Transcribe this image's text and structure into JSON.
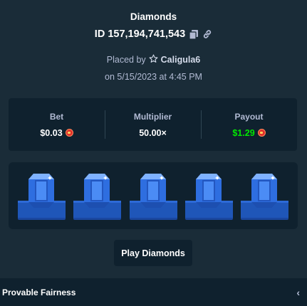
{
  "header": {
    "title": "Diamonds",
    "bet_id": "ID 157,194,741,543",
    "placed_by_prefix": "Placed by",
    "username": "Caligula6",
    "date_text": "on 5/15/2023 at 4:45 PM"
  },
  "stats": {
    "bet_label": "Bet",
    "bet_value": "$0.03",
    "multiplier_label": "Multiplier",
    "multiplier_value": "50.00×",
    "payout_label": "Payout",
    "payout_value": "$1.29"
  },
  "board": {
    "gems": [
      "blue-diamond",
      "blue-diamond",
      "blue-diamond",
      "blue-diamond",
      "blue-diamond"
    ]
  },
  "actions": {
    "play_label": "Play Diamonds"
  },
  "footer": {
    "fairness_label": "Provable Fairness",
    "chevron": "‹"
  },
  "colors": {
    "background": "#1a2c38",
    "panel": "#0f212e",
    "payout": "#00e701",
    "gem": "#3a7bf0"
  }
}
